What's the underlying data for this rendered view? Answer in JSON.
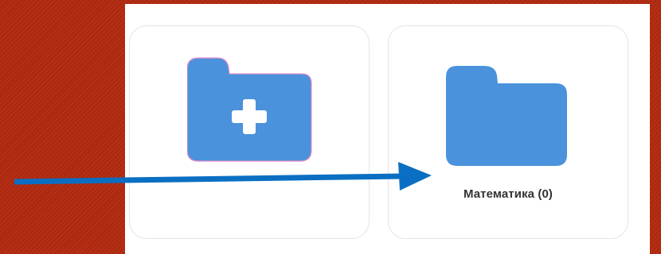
{
  "background": {
    "color": "#b52a10"
  },
  "cards": {
    "new_folder": {
      "icon": "folder-plus-icon",
      "icon_color": "#4a92dc"
    },
    "folder": {
      "icon": "folder-icon",
      "icon_color": "#4a92dc",
      "label": "Математика (0)"
    }
  },
  "annotation": {
    "icon": "arrow-right-icon",
    "color": "#0a6fc2"
  }
}
